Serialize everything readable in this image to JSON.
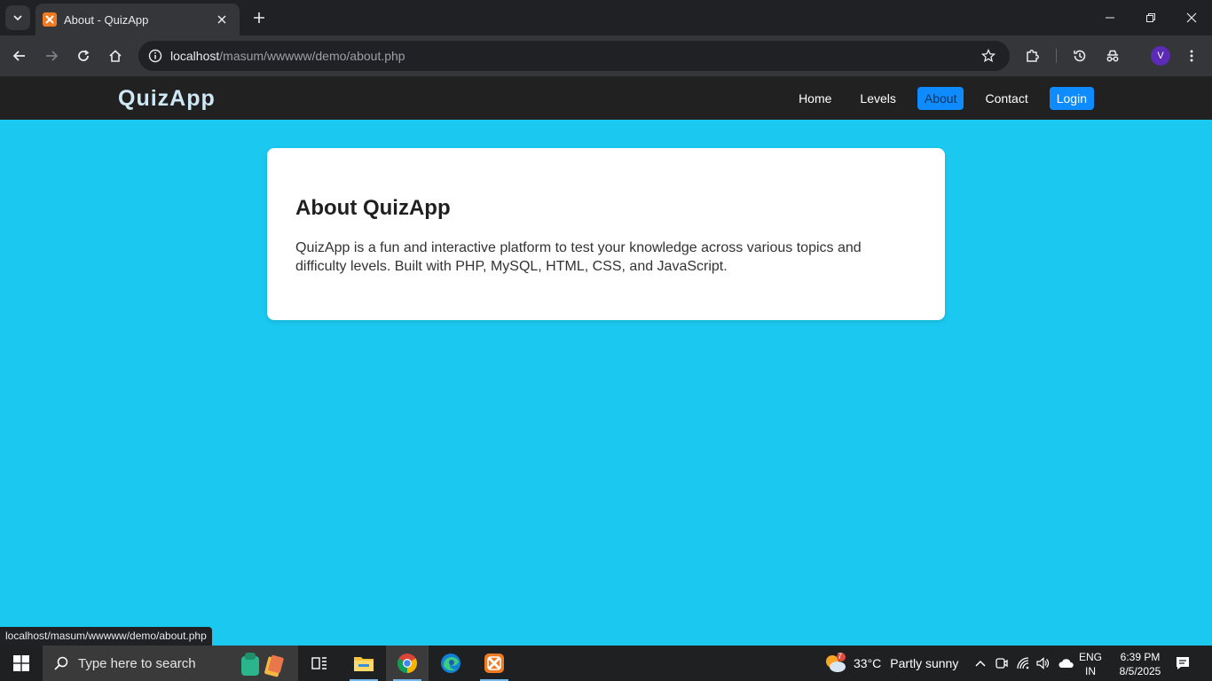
{
  "browser": {
    "tab": {
      "title": "About - QuizApp"
    },
    "address": {
      "host": "localhost",
      "path": "/masum/wwwww/demo/about.php"
    },
    "profile_initial": "V",
    "status_url": "localhost/masum/wwwww/demo/about.php"
  },
  "page": {
    "brand": "QuizApp",
    "nav": {
      "home": "Home",
      "levels": "Levels",
      "about": "About",
      "contact": "Contact",
      "login": "Login"
    },
    "card": {
      "heading": "About QuizApp",
      "body": "QuizApp is a fun and interactive platform to test your knowledge across various topics and difficulty levels. Built with PHP, MySQL, HTML, CSS, and JavaScript."
    }
  },
  "taskbar": {
    "search_placeholder": "Type here to search",
    "weather": {
      "temp": "33°C",
      "condition": "Partly sunny",
      "badge": "7"
    },
    "lang": {
      "line1": "ENG",
      "line2": "IN"
    },
    "clock": {
      "time": "6:39 PM",
      "date": "8/5/2025"
    }
  },
  "colors": {
    "page_bg": "#1bc9f0",
    "navbar_bg": "#212121",
    "accent": "#0d8bff"
  }
}
